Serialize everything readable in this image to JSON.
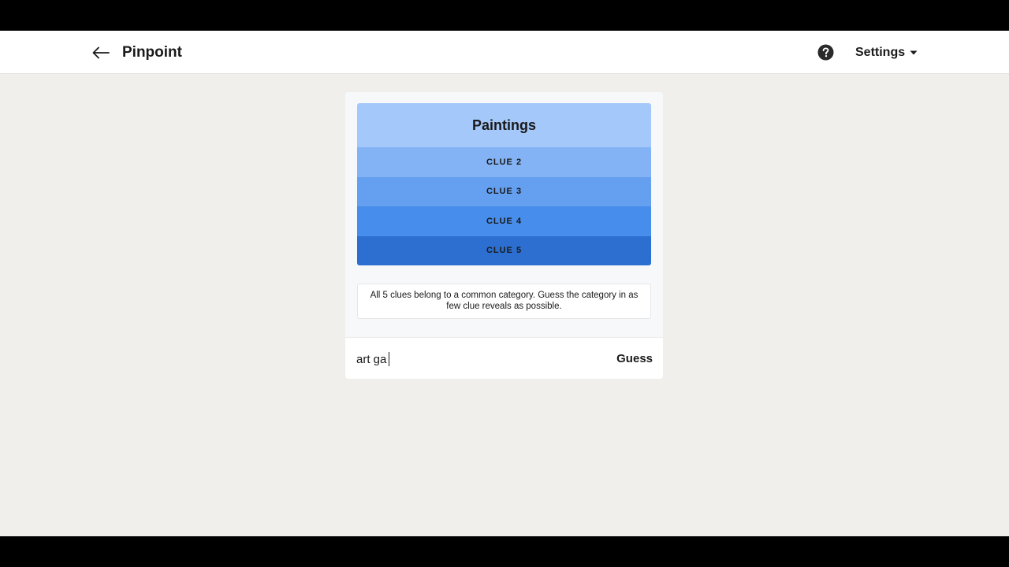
{
  "header": {
    "title": "Pinpoint",
    "back_icon": "arrow-left-icon",
    "help_icon": "question-circle-icon",
    "settings_label": "Settings",
    "settings_icon": "caret-down-icon"
  },
  "board": {
    "clues": [
      {
        "label": "Paintings",
        "state": "revealed",
        "color": "#a4c8fa"
      },
      {
        "label": "CLUE 2",
        "state": "hidden",
        "color": "#83b3f4"
      },
      {
        "label": "CLUE 3",
        "state": "hidden",
        "color": "#659ff0"
      },
      {
        "label": "CLUE 4",
        "state": "hidden",
        "color": "#478deb"
      },
      {
        "label": "CLUE 5",
        "state": "hidden",
        "color": "#2c6fd0"
      }
    ],
    "instructions": "All 5 clues belong to a common category. Guess the category in as few clue reveals as possible."
  },
  "guess": {
    "input_value": "art ga",
    "button_label": "Guess"
  },
  "colors": {
    "page_background": "#f0efeb",
    "header_background": "#ffffff",
    "card_background": "#f7f8fa"
  }
}
